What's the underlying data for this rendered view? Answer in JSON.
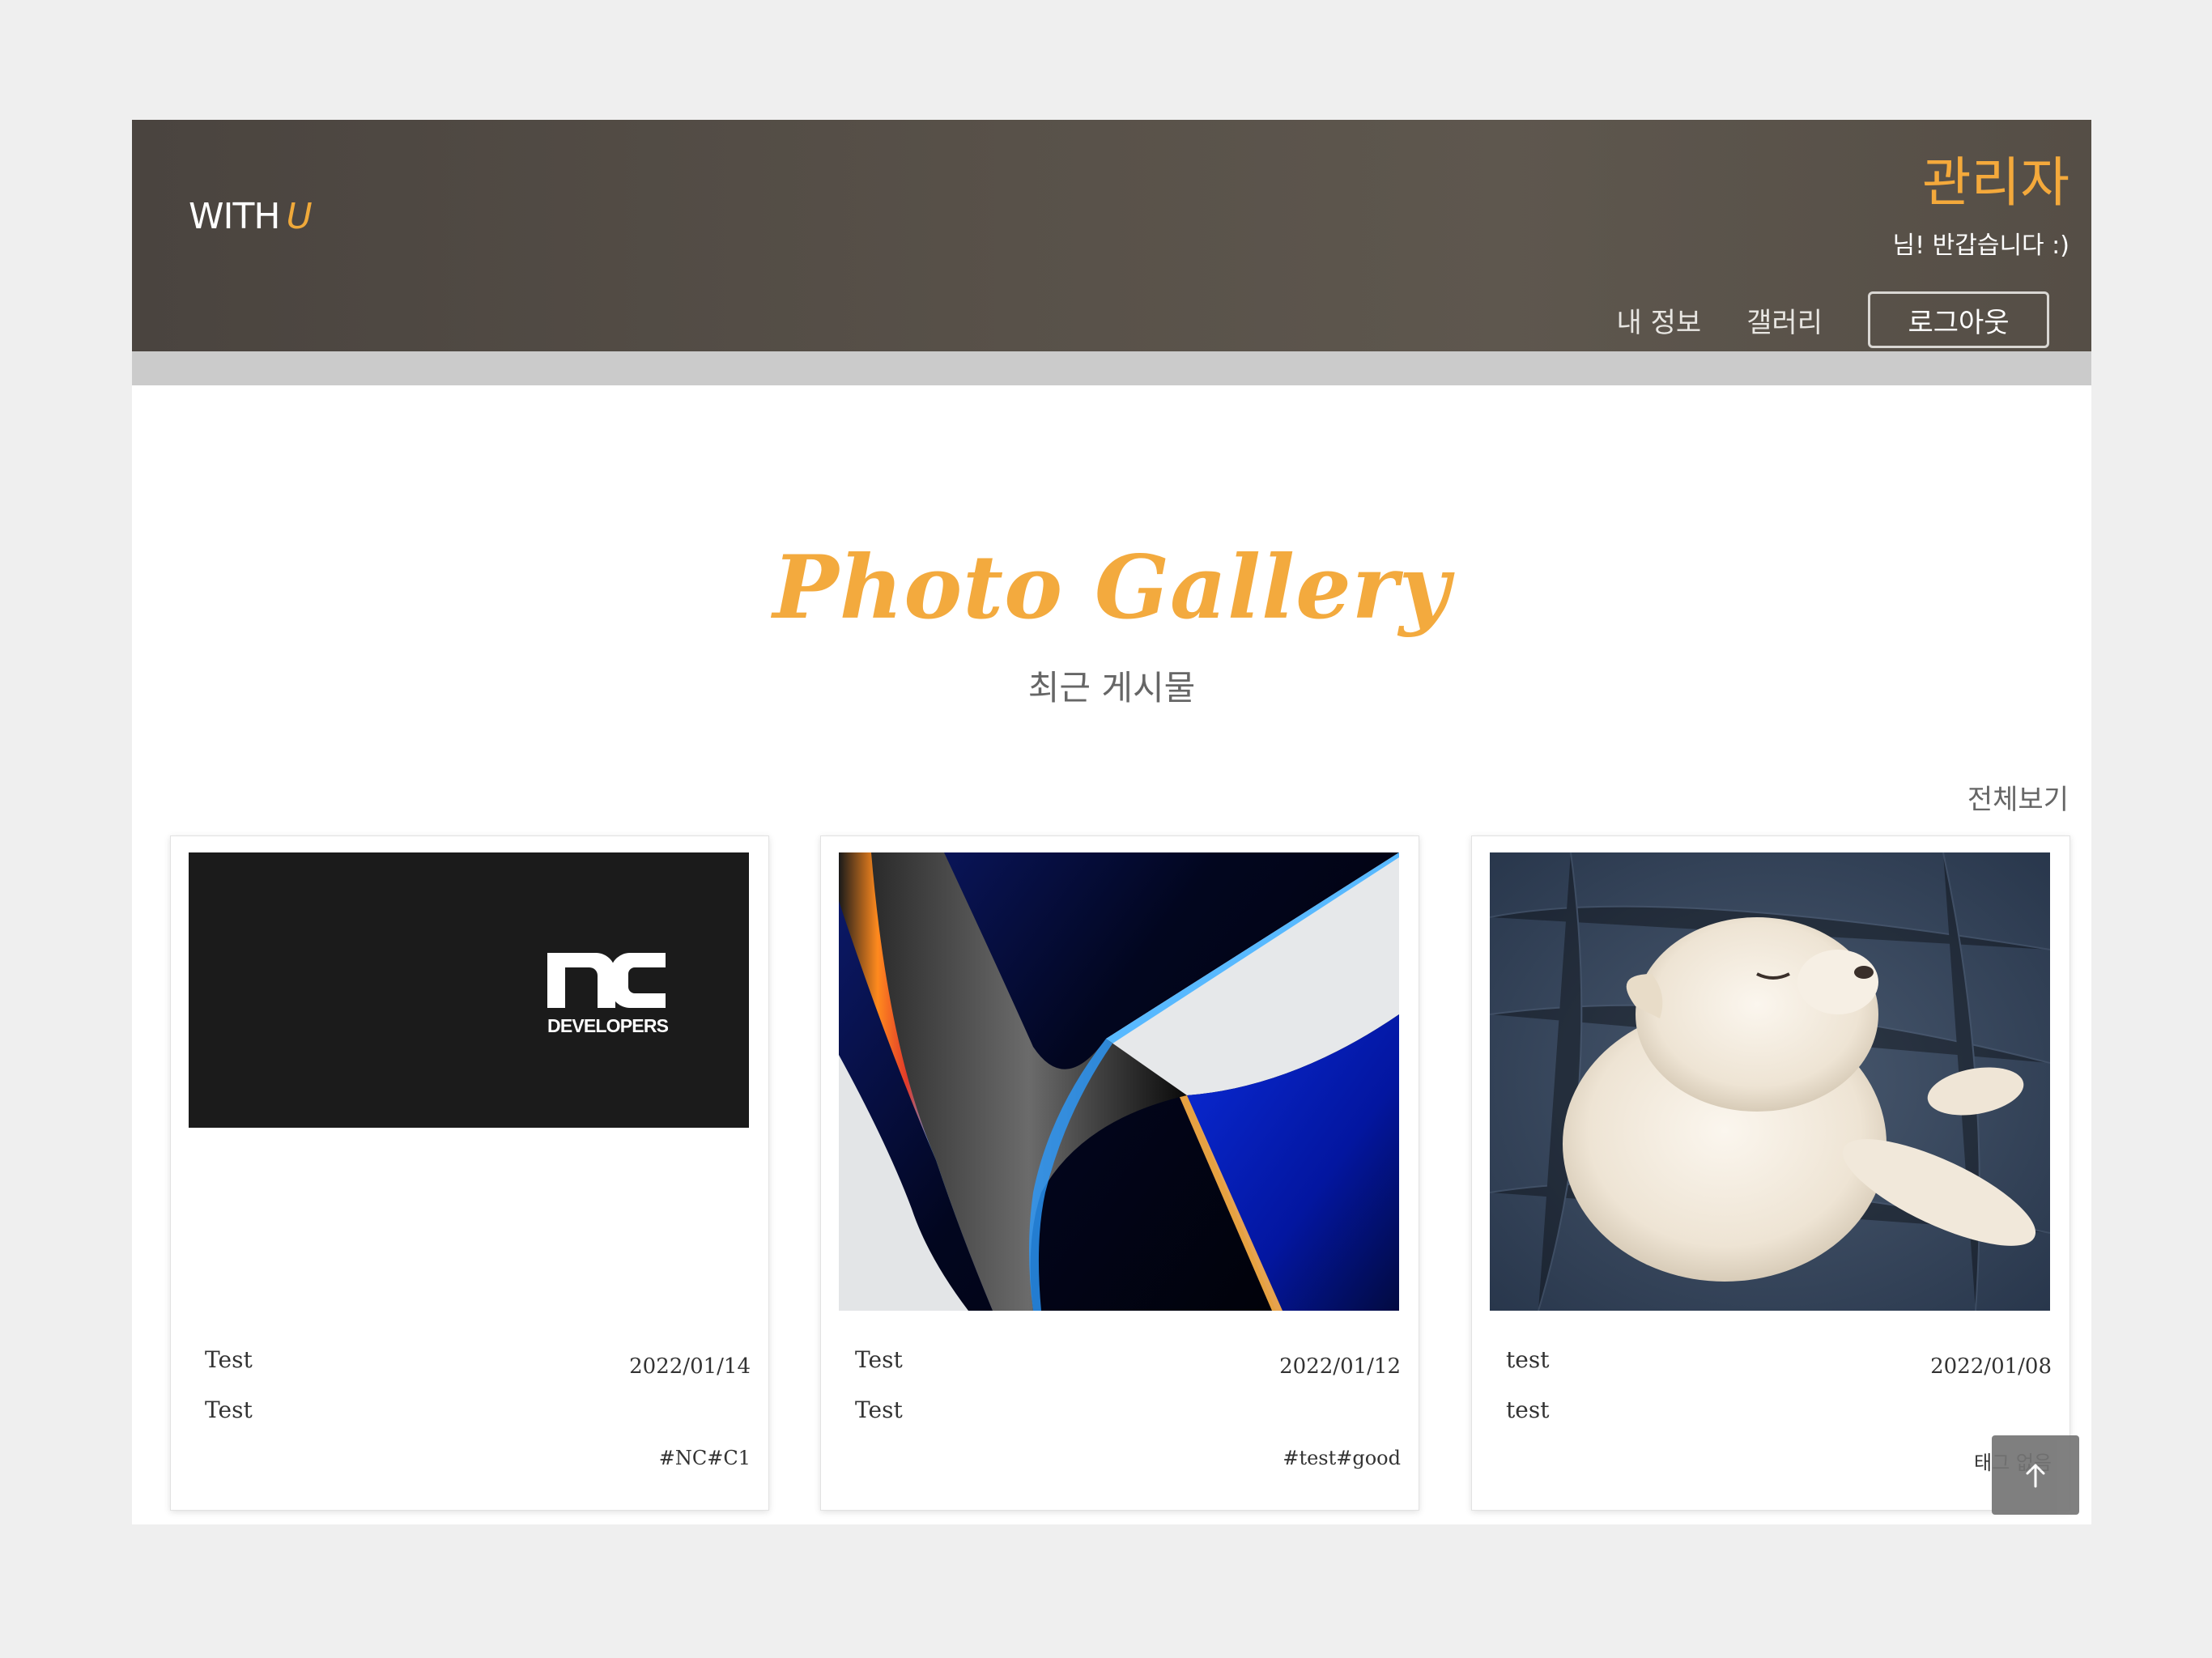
{
  "header": {
    "brand_main": "WITH",
    "brand_accent": "U",
    "user_name": "관리자",
    "greeting": "님! 반갑습니다 :)",
    "nav": {
      "my_info": "내 정보",
      "gallery": "갤러리",
      "logout": "로그아웃"
    }
  },
  "section": {
    "title": "Photo Gallery",
    "subtitle": "최근 게시물",
    "view_all": "전체보기"
  },
  "posts": [
    {
      "title": "Test",
      "content": "Test",
      "date": "2022/01/14",
      "tags": "#NC#C1",
      "image": "nc-developers-logo",
      "logo_top": "nc",
      "logo_bottom": "DEVELOPERS"
    },
    {
      "title": "Test",
      "content": "Test",
      "date": "2022/01/12",
      "tags": "#test#good",
      "image": "abstract-wallpaper"
    },
    {
      "title": "test",
      "content": "test",
      "date": "2022/01/08",
      "tags": "태그 없음",
      "image": "sleeping-puppy"
    }
  ],
  "colors": {
    "accent": "#f3aa3e",
    "header_bg": "#554e46"
  }
}
